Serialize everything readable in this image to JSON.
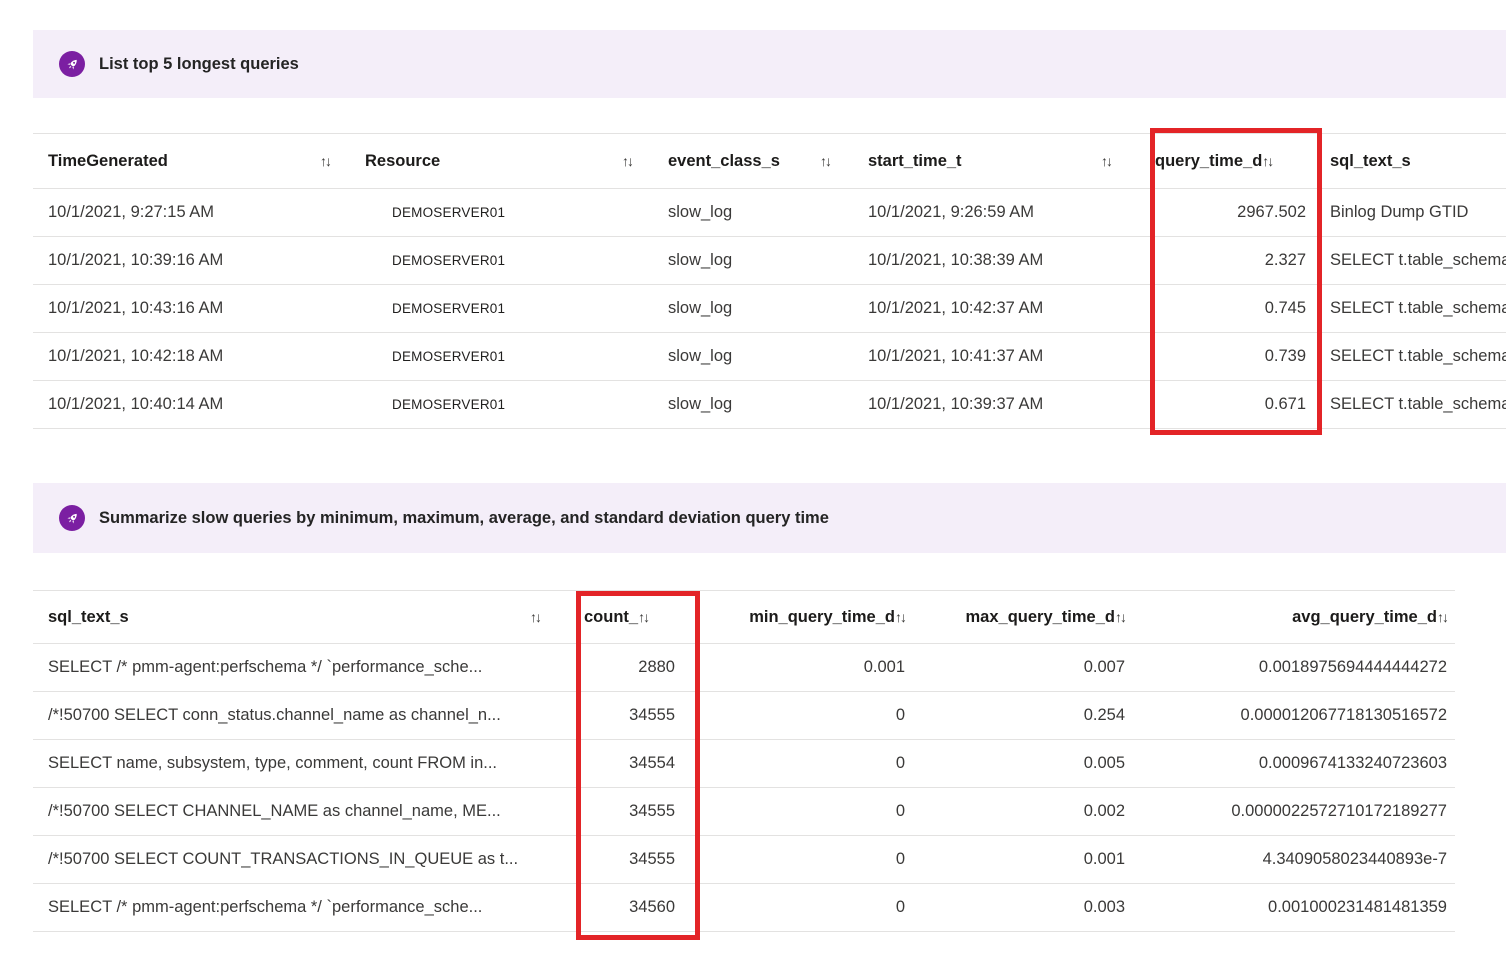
{
  "sort_icon": "↑↓",
  "colors": {
    "banner_bg": "#f4eef9",
    "icon_bg": "#7b1fa2",
    "highlight_border": "#e32427",
    "row_border": "#e3e2e1",
    "header_text": "#1c1b1a",
    "cell_text": "#3a3938"
  },
  "banners": [
    {
      "label": "List top 5 longest queries"
    },
    {
      "label": "Summarize slow queries by minimum, maximum, average, and standard deviation query time"
    }
  ],
  "table1": {
    "headers": [
      "TimeGenerated",
      "Resource",
      "event_class_s",
      "start_time_t",
      "query_time_d",
      "sql_text_s"
    ],
    "rows": [
      [
        "10/1/2021, 9:27:15 AM",
        "DEMOSERVER01",
        "slow_log",
        "10/1/2021, 9:26:59 AM",
        "2967.502",
        "Binlog Dump GTID"
      ],
      [
        "10/1/2021, 10:39:16 AM",
        "DEMOSERVER01",
        "slow_log",
        "10/1/2021, 10:38:39 AM",
        "2.327",
        "SELECT t.table_schema"
      ],
      [
        "10/1/2021, 10:43:16 AM",
        "DEMOSERVER01",
        "slow_log",
        "10/1/2021, 10:42:37 AM",
        "0.745",
        "SELECT t.table_schema"
      ],
      [
        "10/1/2021, 10:42:18 AM",
        "DEMOSERVER01",
        "slow_log",
        "10/1/2021, 10:41:37 AM",
        "0.739",
        "SELECT t.table_schema"
      ],
      [
        "10/1/2021, 10:40:14 AM",
        "DEMOSERVER01",
        "slow_log",
        "10/1/2021, 10:39:37 AM",
        "0.671",
        "SELECT t.table_schema"
      ]
    ]
  },
  "table2": {
    "headers": [
      "sql_text_s",
      "count_",
      "min_query_time_d",
      "max_query_time_d",
      "avg_query_time_d"
    ],
    "rows": [
      [
        "SELECT /* pmm-agent:perfschema */ `performance_sche...",
        "2880",
        "0.001",
        "0.007",
        "0.0018975694444444272"
      ],
      [
        "/*!50700 SELECT conn_status.channel_name as channel_n...",
        "34555",
        "0",
        "0.254",
        "0.000012067718130516572"
      ],
      [
        "SELECT name, subsystem, type, comment, count FROM in...",
        "34554",
        "0",
        "0.005",
        "0.0009674133240723603"
      ],
      [
        "/*!50700 SELECT CHANNEL_NAME as channel_name, ME...",
        "34555",
        "0",
        "0.002",
        "0.0000022572710172189277"
      ],
      [
        "/*!50700 SELECT COUNT_TRANSACTIONS_IN_QUEUE as t...",
        "34555",
        "0",
        "0.001",
        "4.3409058023440893e-7"
      ],
      [
        "SELECT /* pmm-agent:perfschema */ `performance_sche...",
        "34560",
        "0",
        "0.003",
        "0.001000231481481359"
      ]
    ]
  }
}
